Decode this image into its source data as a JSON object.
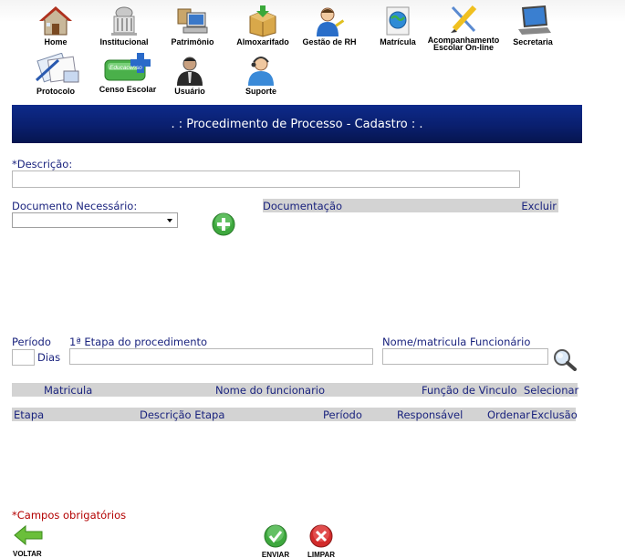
{
  "nav": {
    "items": [
      {
        "label": "Home",
        "icon": "home-icon"
      },
      {
        "label": "Institucional",
        "icon": "institucional-building-icon"
      },
      {
        "label": "Patrimônio",
        "icon": "patrimonio-computer-icon"
      },
      {
        "label": "Almoxarifado",
        "icon": "almoxarifado-box-icon"
      },
      {
        "label": "Gestão de RH",
        "icon": "rh-person-icon"
      },
      {
        "label": "Matrícula",
        "icon": "matricula-globe-icon"
      },
      {
        "label": "Acompanhamento\nEscolar On-line",
        "icon": "acompanhamento-pencil-icon"
      },
      {
        "label": "Secretaria",
        "icon": "secretaria-laptop-icon"
      },
      {
        "label": "Protocolo",
        "icon": "protocolo-documents-icon"
      },
      {
        "label": "Censo Escolar",
        "icon": "censo-escolar-icon"
      },
      {
        "label": "Usuário",
        "icon": "usuario-person-icon"
      },
      {
        "label": "Suporte",
        "icon": "suporte-headset-icon"
      }
    ],
    "censo_badge": "Educacenso"
  },
  "page": {
    "title": ". : Procedimento de Processo - Cadastro : ."
  },
  "form": {
    "descricao_label": "*Descrição:",
    "descricao_value": "",
    "documento_label": "Documento Necessário:",
    "documento_selected": "",
    "doc_grid": {
      "documentacao": "Documentação",
      "excluir": "Excluir"
    },
    "periodo_label": "Período",
    "dias_label": "Dias",
    "etapa_label": "1ª Etapa do procedimento",
    "funcionario_label": "Nome/matricula Funcionário",
    "func_grid": {
      "matricula": "Matricula",
      "nome": "Nome do funcionario",
      "funcao": "Função de Vinculo",
      "selecionar": "Selecionar"
    },
    "etapa_grid": {
      "etapa": "Etapa",
      "descricao": "Descrição Etapa",
      "periodo": "Período",
      "responsavel": "Responsável",
      "ordenar": "Ordenar",
      "exclusao": "Exclusão"
    },
    "required_note": "*Campos obrigatórios"
  },
  "actions": {
    "voltar": "VOLTAR",
    "enviar": "ENVIAR",
    "limpar": "LIMPAR"
  },
  "colors": {
    "title_bar": "#0a1f6e",
    "label_text": "#1a237e",
    "grid_header": "#d3d3d3",
    "required_text": "#b30000"
  }
}
